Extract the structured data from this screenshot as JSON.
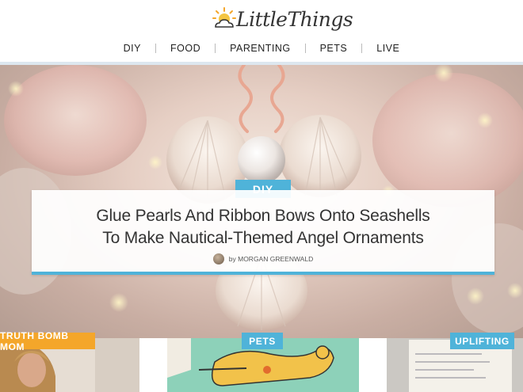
{
  "brand": {
    "name": "LittleThings"
  },
  "nav": {
    "items": [
      "DIY",
      "FOOD",
      "PARENTING",
      "PETS",
      "LIVE"
    ]
  },
  "hero": {
    "category": "DIY",
    "title_line1": "Glue Pearls And Ribbon Bows Onto Seashells",
    "title_line2": "To Make Nautical-Themed Angel Ornaments",
    "byline": "by MORGAN GREENWALD"
  },
  "tiles": [
    {
      "tag": "TRUTH BOMB MOM",
      "tag_color": "#f4a62a"
    },
    {
      "tag": "PETS",
      "tag_color": "#4fb3d9"
    },
    {
      "tag": "UPLIFTING",
      "tag_color": "#4fb3d9"
    }
  ],
  "colors": {
    "accent": "#4fb3d9",
    "orange": "#f4a62a"
  }
}
